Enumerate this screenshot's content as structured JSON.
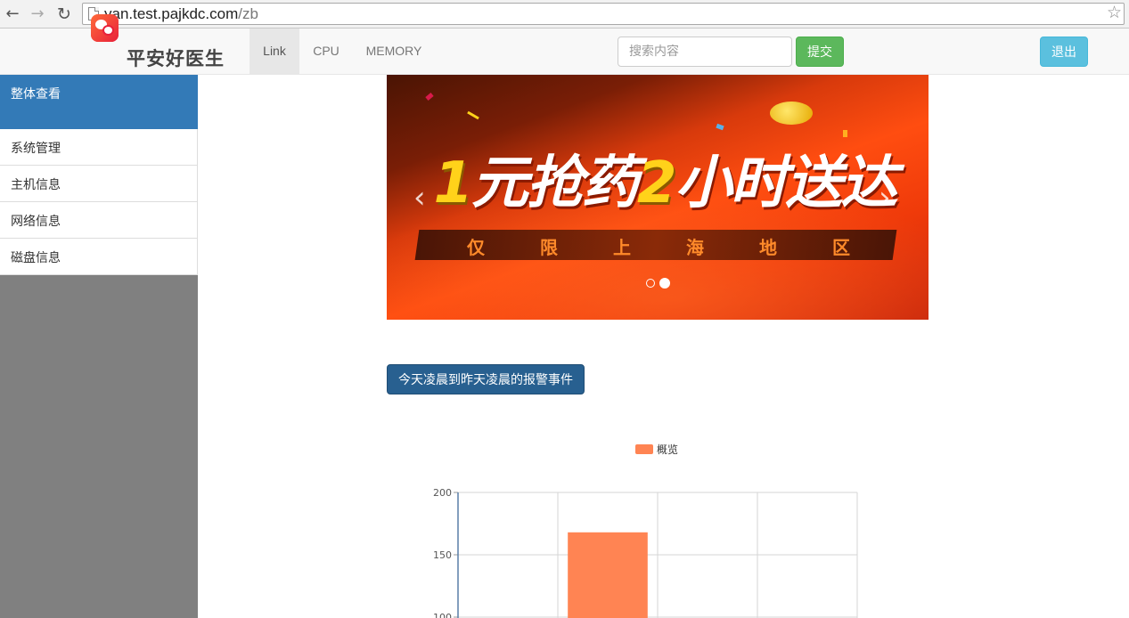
{
  "browser": {
    "url_host": "yan.test.pajkdc.com",
    "url_path": "/zb"
  },
  "navbar": {
    "brand": "平安好医生",
    "tabs": [
      {
        "label": "Link",
        "active": true
      },
      {
        "label": "CPU",
        "active": false
      },
      {
        "label": "MEMORY",
        "active": false
      }
    ],
    "search_placeholder": "搜索内容",
    "submit_label": "提交",
    "logout_label": "退出"
  },
  "sidebar": {
    "active": "整体查看",
    "items": [
      "系统管理",
      "主机信息",
      "网络信息",
      "磁盘信息"
    ]
  },
  "carousel": {
    "headline_1": "1",
    "headline_2": "元抢药",
    "headline_3": "2",
    "headline_4": "小时送达",
    "band_chars": [
      "仅",
      "限",
      "上",
      "海",
      "地",
      "区"
    ],
    "slides": 2,
    "active_slide": 2
  },
  "alarm_button_label": "今天凌晨到昨天凌晨的报警事件",
  "colors": {
    "primary": "#337ab7",
    "success": "#5cb85c",
    "info": "#5bc0de",
    "bar": "#ff8453"
  },
  "chart_data": {
    "type": "bar",
    "series": [
      {
        "name": "概览",
        "values": [
          null,
          168,
          null,
          null
        ]
      }
    ],
    "categories": [
      "",
      "",
      "",
      ""
    ],
    "yticks": [
      100,
      150,
      200
    ],
    "ylim": [
      100,
      200
    ],
    "grid": true,
    "legend": "top-center"
  }
}
